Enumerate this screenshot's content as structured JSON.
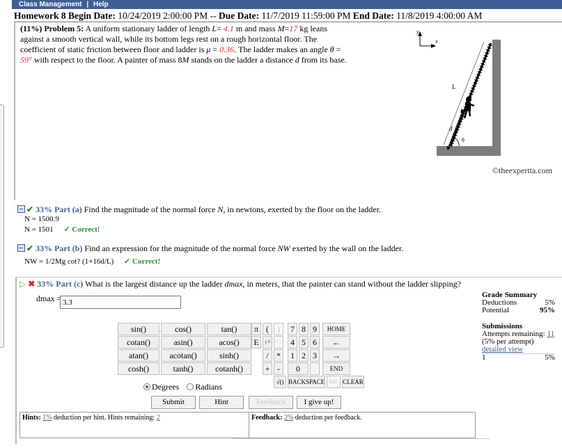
{
  "topbar": {
    "menu1": "Class Management",
    "sep": "|",
    "menu2": "Help"
  },
  "header": {
    "hw": "Homework 8",
    "begin_label": "Begin Date:",
    "begin": "10/24/2019 2:00:00 PM",
    "sep": "--",
    "due_label": "Due Date:",
    "due": "11/7/2019 11:59:00 PM",
    "end_label": "End Date:",
    "end": "11/8/2019 4:00:00 AM"
  },
  "problem": {
    "head": "(11%) Problem 5:",
    "t1": "A uniform stationary ladder of length",
    "L_sym": "L",
    "eq": "=",
    "L_val": "4.1",
    "t2": "m and mass",
    "M_sym": "M",
    "M_val": "17",
    "t3": "kg leans against a smooth vertical wall, while its bottom legs rest on a rough horizontal floor. The coefficient of static friction between floor and ladder is",
    "mu_sym": "μ",
    "mu_val": "0.36",
    "t4": ". The ladder makes an angle",
    "theta_sym": "θ",
    "theta_val": "59°",
    "t5": "with respect to the floor. A painter of mass",
    "t5b": "8",
    "t6": "stands on the ladder a distance",
    "d_sym": "d",
    "t7": "from its base.",
    "credit": "©theexpertta.com",
    "fig_labels": {
      "y": "y",
      "x": "x",
      "L": "L",
      "d": "d",
      "theta": "θ"
    }
  },
  "part_a": {
    "pct": "33% Part (a)",
    "question_prefix": "Find the magnitude of the normal force",
    "sym": "N",
    "question_suffix": ", in newtons, exerted by the floor on the ladder.",
    "line1": "N = 1500.9",
    "line2": "N = 1501",
    "correct": "✓ Correct!"
  },
  "part_b": {
    "pct": "33% Part (b)",
    "question_prefix": "Find an expression for the magnitude of the normal force",
    "sym": "NW",
    "question_suffix": "exerted by the wall on the ladder.",
    "line1": "NW = 1/2Mg cot? (1+16d/L)",
    "correct": "✓ Correct!"
  },
  "part_c": {
    "pct": "33% Part (c)",
    "question_prefix": "What is the largest distance up the ladder",
    "sym": "dmax",
    "question_suffix": ", in meters, that the painter can stand without the ladder slipping?",
    "input_label": "dmax =",
    "input_value": "3.3"
  },
  "keypad": {
    "funcs": [
      [
        "sin()",
        "cos()",
        "tan()"
      ],
      [
        "cotan()",
        "asin()",
        "acos()"
      ],
      [
        "atan()",
        "acotan()",
        "sinh()"
      ],
      [
        "cosh()",
        "tanh()",
        "cotanh()"
      ]
    ],
    "degrees": "Degrees",
    "radians": "Radians",
    "pi": "π",
    "lparen": "(",
    "rparen": ")",
    "E": "E",
    "up": "↑^",
    "upup": "^↓",
    "slash": "/",
    "star": "*",
    "plus": "+",
    "minus": "-",
    "sqrt": "√()",
    "n7": "7",
    "n8": "8",
    "n9": "9",
    "n4": "4",
    "n5": "5",
    "n6": "6",
    "n1": "1",
    "n2": "2",
    "n3": "3",
    "n0": "0",
    "dot": ".",
    "home": "HOME",
    "left": "←",
    "right": "→",
    "end": "END",
    "backspace": "BACKSPACE",
    "del": "DEL",
    "clear": "CLEAR"
  },
  "buttons": {
    "submit": "Submit",
    "hint": "Hint",
    "feedback": "Feedback",
    "giveup": "I give up!"
  },
  "grade": {
    "title": "Grade Summary",
    "deductions_label": "Deductions",
    "deductions": "5%",
    "potential_label": "Potential",
    "potential": "95%",
    "submissions_title": "Submissions",
    "attempts_label": "Attempts remaining:",
    "attempts": "11",
    "per_attempt": "(5% per attempt)",
    "detailed": "detailed view",
    "row_num": "1",
    "row_val": "5%"
  },
  "hints": {
    "label": "Hints:",
    "pct": "1%",
    "text": "deduction per hint. Hints remaining:",
    "remaining": "2"
  },
  "feedback": {
    "label": "Feedback:",
    "pct": "2%",
    "text": "deduction per feedback."
  }
}
